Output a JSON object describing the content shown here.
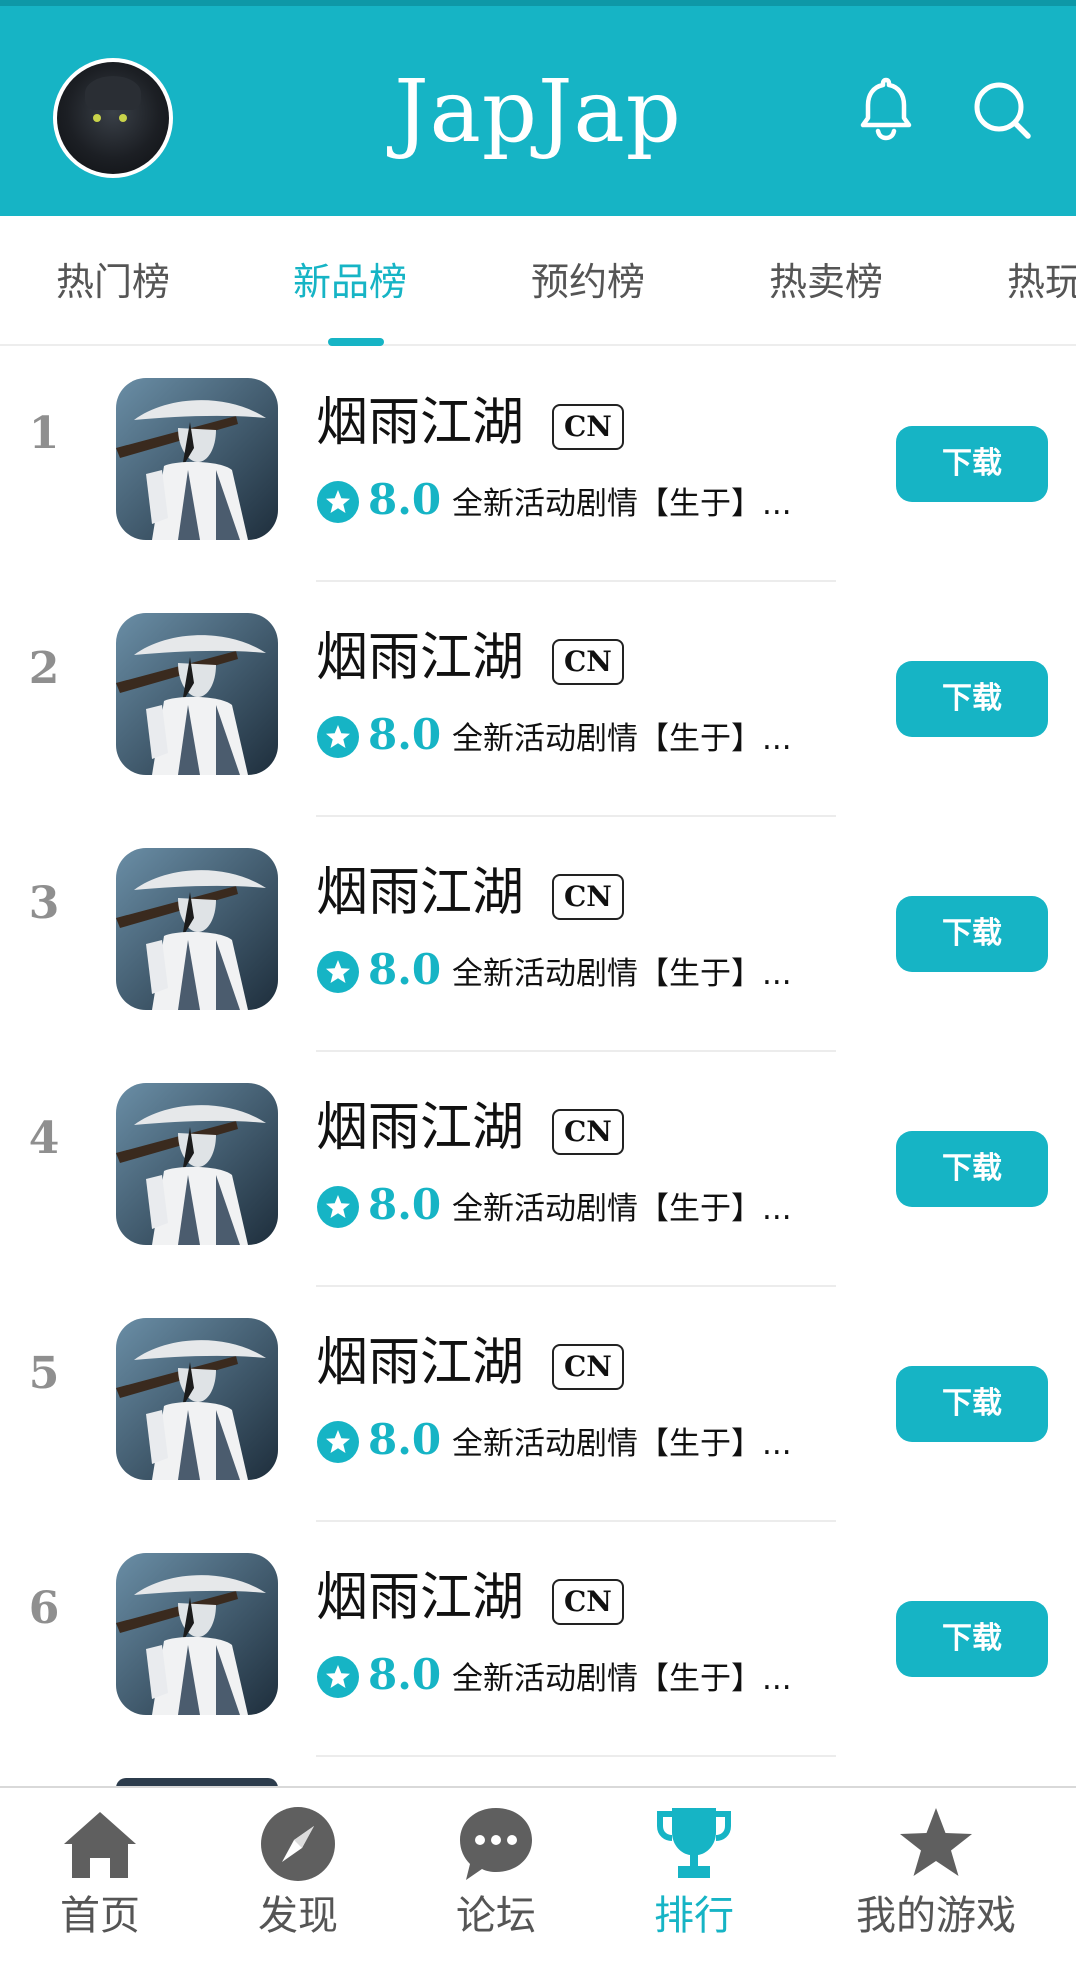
{
  "header": {
    "title": "JapJap",
    "avatar_icon": "user-avatar",
    "notification_icon": "bell-icon",
    "search_icon": "search-icon",
    "accent_color": "#16b4c5"
  },
  "tabs": [
    {
      "label": "热门榜",
      "active": false
    },
    {
      "label": "新品榜",
      "active": true
    },
    {
      "label": "预约榜",
      "active": false
    },
    {
      "label": "热卖榜",
      "active": false
    },
    {
      "label": "热玩",
      "active": false
    }
  ],
  "games": [
    {
      "rank": "1",
      "name": "烟雨江湖",
      "region": "CN",
      "rating": "8.0",
      "desc": "全新活动剧情【生于】...",
      "button": "下载"
    },
    {
      "rank": "2",
      "name": "烟雨江湖",
      "region": "CN",
      "rating": "8.0",
      "desc": "全新活动剧情【生于】...",
      "button": "下载"
    },
    {
      "rank": "3",
      "name": "烟雨江湖",
      "region": "CN",
      "rating": "8.0",
      "desc": "全新活动剧情【生于】...",
      "button": "下载"
    },
    {
      "rank": "4",
      "name": "烟雨江湖",
      "region": "CN",
      "rating": "8.0",
      "desc": "全新活动剧情【生于】...",
      "button": "下载"
    },
    {
      "rank": "5",
      "name": "烟雨江湖",
      "region": "CN",
      "rating": "8.0",
      "desc": "全新活动剧情【生于】...",
      "button": "下载"
    },
    {
      "rank": "6",
      "name": "烟雨江湖",
      "region": "CN",
      "rating": "8.0",
      "desc": "全新活动剧情【生于】...",
      "button": "下载"
    }
  ],
  "bottom_nav": [
    {
      "label": "首页",
      "icon": "home-icon",
      "active": false
    },
    {
      "label": "发现",
      "icon": "compass-icon",
      "active": false
    },
    {
      "label": "论坛",
      "icon": "chat-bubble-icon",
      "active": false
    },
    {
      "label": "排行",
      "icon": "trophy-icon",
      "active": true
    },
    {
      "label": "我的游戏",
      "icon": "star-icon",
      "active": false
    }
  ]
}
